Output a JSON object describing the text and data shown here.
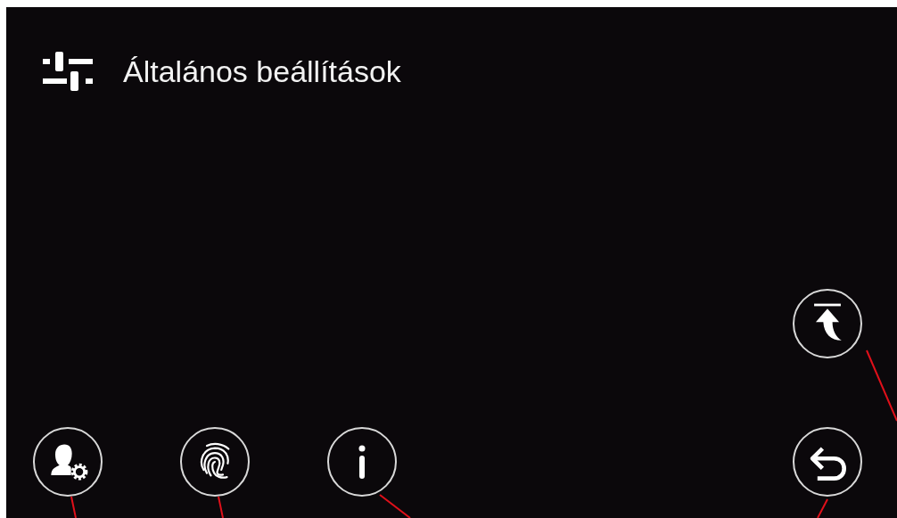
{
  "screen": {
    "title": "Általános beállítások"
  }
}
